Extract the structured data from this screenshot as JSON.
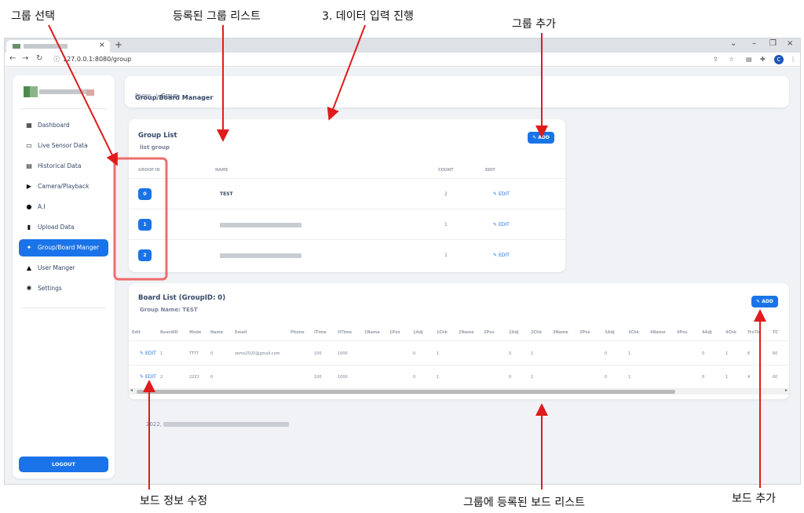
{
  "annotations": {
    "select_group": "그룹 선택",
    "registered_groups": "등록된 그룹 리스트",
    "data_entry": "3. 데이터 입력 진행",
    "add_group": "그룹 추가",
    "edit_board": "보드 정보 수정",
    "board_list": "그룹에 등록된 보드 리스트",
    "add_board": "보드 추가"
  },
  "browser": {
    "url": "127.0.0.1:8080/group",
    "profile_initial": "C"
  },
  "sidebar": {
    "items": [
      {
        "label": "Dashboard",
        "icon": "dashboard-icon",
        "glyph": "▦"
      },
      {
        "label": "Live Sensor Data",
        "icon": "cast-icon",
        "glyph": "▭"
      },
      {
        "label": "Historical Data",
        "icon": "library-icon",
        "glyph": "▤"
      },
      {
        "label": "Camera/Playback",
        "icon": "play-circle-icon",
        "glyph": "▶"
      },
      {
        "label": "A.I",
        "icon": "map-pin-icon",
        "glyph": "●"
      },
      {
        "label": "Upload Data",
        "icon": "file-upload-icon",
        "glyph": "▮"
      },
      {
        "label": "Group/Board Manger",
        "icon": "group-icon",
        "glyph": "✦"
      },
      {
        "label": "User Manger",
        "icon": "person-icon",
        "glyph": "▲"
      },
      {
        "label": "Settings",
        "icon": "gear-icon",
        "glyph": "✱"
      }
    ],
    "active_index": 6,
    "logout": "LOGOUT"
  },
  "header": {
    "crumb_pages": "Pages",
    "crumb_sep": "/",
    "crumb_current": "Group",
    "title": "Group/Board Manager"
  },
  "group_list": {
    "title": "Group List",
    "subtitle": "list group",
    "add": "ADD",
    "headers": {
      "id": "GROUP ID",
      "name": "NAME",
      "count": "COUNT",
      "edit": "EDIT"
    },
    "rows": [
      {
        "id": "0",
        "name": "TEST",
        "count": "2",
        "edit": "EDIT"
      },
      {
        "id": "1",
        "name": "",
        "count": "1",
        "edit": "EDIT"
      },
      {
        "id": "2",
        "name": "",
        "count": "1",
        "edit": "EDIT"
      }
    ]
  },
  "board_list": {
    "title": "Board List (GroupID: 0)",
    "subtitle": "Group Name: TEST",
    "add": "ADD",
    "columns": [
      "Edit",
      "BoardID",
      "Mode",
      "Name",
      "Email",
      "Phone",
      "ITime",
      "OTime",
      "1Name",
      "1Pos",
      "1Adj",
      "1Chk",
      "2Name",
      "2Pos",
      "2Adj",
      "2Chk",
      "3Name",
      "3Pos",
      "3Adj",
      "3Chk",
      "4Name",
      "4Pos",
      "4Adj",
      "4Chk",
      "TrsTh",
      "TC"
    ],
    "rows": [
      [
        "EDIT",
        "1",
        "TTTT",
        "0",
        "zemo2020@gmail.com",
        "",
        "100",
        "1000",
        "",
        "",
        "0",
        "1",
        "",
        "",
        "0",
        "1",
        "",
        "",
        "0",
        "1",
        "",
        "",
        "0",
        "1",
        "6",
        "60"
      ],
      [
        "EDIT",
        "2",
        "2222",
        "0",
        "",
        "",
        "100",
        "1000",
        "",
        "",
        "0",
        "1",
        "",
        "",
        "0",
        "1",
        "",
        "",
        "0",
        "1",
        "",
        "",
        "0",
        "1",
        "4",
        "60"
      ]
    ]
  },
  "footer": {
    "year": "2022,"
  }
}
